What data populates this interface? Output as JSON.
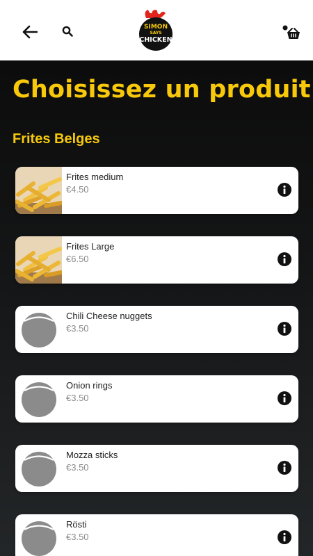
{
  "header": {
    "logo_text": [
      "SIMON",
      "SAYS",
      "CHICKEN"
    ],
    "back_icon": "arrow-left-icon",
    "search_icon": "search-icon",
    "cart_icon": "basket-icon"
  },
  "main": {
    "title": "Choisissez un produit",
    "section_title": "Frites Belges",
    "products": [
      {
        "name": "Frites medium",
        "price": "€4.50",
        "image": "fries"
      },
      {
        "name": "Frites Large",
        "price": "€6.50",
        "image": "fries"
      },
      {
        "name": "Chili Cheese nuggets",
        "price": "€3.50",
        "image": "placeholder"
      },
      {
        "name": "Onion rings",
        "price": "€3.50",
        "image": "placeholder"
      },
      {
        "name": "Mozza sticks",
        "price": "€3.50",
        "image": "placeholder"
      },
      {
        "name": "Rösti",
        "price": "€3.50",
        "image": "placeholder"
      }
    ]
  },
  "colors": {
    "accent": "#f7c90a",
    "background": "#0c0c0c",
    "card": "#ffffff",
    "price": "#8a8a8a",
    "placeholder": "#8b8b8b"
  }
}
